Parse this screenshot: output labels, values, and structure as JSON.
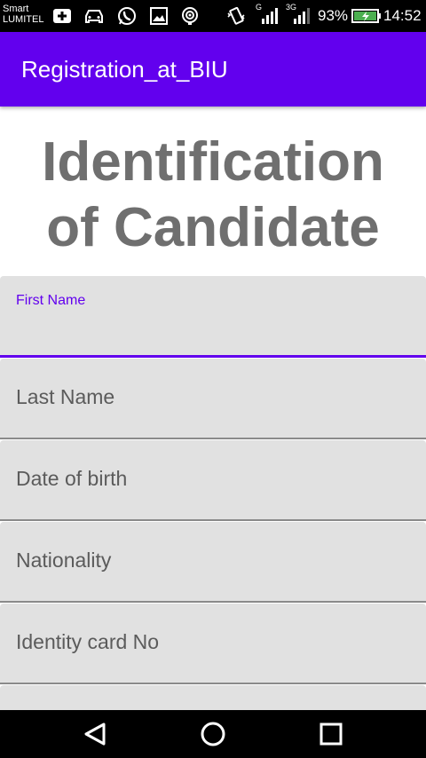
{
  "status_bar": {
    "carrier_line1": "Smart",
    "carrier_line2": "LUMITEL",
    "network_g": "G",
    "network_3g": "3G",
    "battery_percent": "93%",
    "time": "14:52",
    "icons": [
      "plus-box-icon",
      "car-icon",
      "whatsapp-icon",
      "image-icon",
      "radar-icon",
      "vibrate-icon",
      "signal-icon",
      "signal-3g-icon",
      "battery-charging-icon"
    ]
  },
  "app_bar": {
    "title": "Registration_at_BIU"
  },
  "heading": {
    "line1": "Identification",
    "line2": "of Candidate"
  },
  "form": {
    "first_name": {
      "label": "First Name",
      "value": ""
    },
    "last_name": {
      "label": "Last Name",
      "value": ""
    },
    "date_of_birth": {
      "label": "Date of birth",
      "value": ""
    },
    "nationality": {
      "label": "Nationality",
      "value": ""
    },
    "identity_card": {
      "label": "Identity card No",
      "value": ""
    }
  },
  "nav_bar": {
    "icons": [
      "back-icon",
      "home-icon",
      "recents-icon"
    ]
  },
  "colors": {
    "primary": "#6200ee",
    "field_bg": "#e1e1e1",
    "heading": "#6f6f6f"
  }
}
